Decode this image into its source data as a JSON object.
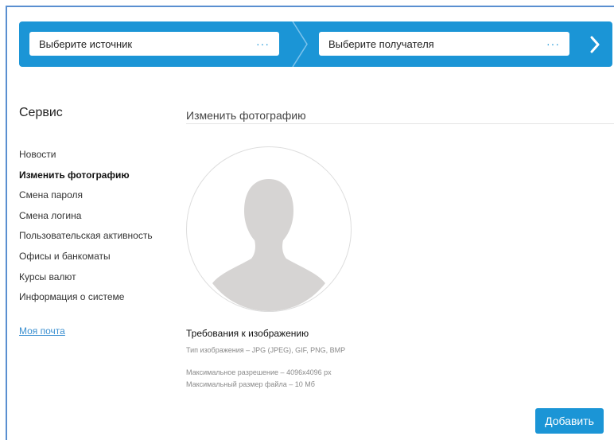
{
  "transfer": {
    "source_placeholder": "Выберите источник",
    "target_placeholder": "Выберите получателя",
    "more_glyph": "···",
    "next_icon": "chevron-right-icon",
    "accent_color": "#1b95d6"
  },
  "sidebar": {
    "title": "Сервис",
    "items": [
      {
        "label": "Новости",
        "active": false
      },
      {
        "label": "Изменить фотографию",
        "active": true
      },
      {
        "label": "Смена пароля",
        "active": false
      },
      {
        "label": "Смена логина",
        "active": false
      },
      {
        "label": "Пользовательская активность",
        "active": false
      },
      {
        "label": "Офисы и банкоматы",
        "active": false
      },
      {
        "label": "Курсы валют",
        "active": false
      },
      {
        "label": "Информация о системе",
        "active": false
      }
    ],
    "mail_link": "Моя почта"
  },
  "main": {
    "title": "Изменить фотографию",
    "avatar_icon": "user-silhouette-icon",
    "requirements": {
      "title": "Требования к изображению",
      "type": "Тип изображения – JPG (JPEG), GIF, PNG, BMP",
      "resolution": "Максимальное разрешение – 4096х4096 px",
      "size": "Максимальный размер файла – 10 Мб"
    },
    "add_button": "Добавить"
  }
}
